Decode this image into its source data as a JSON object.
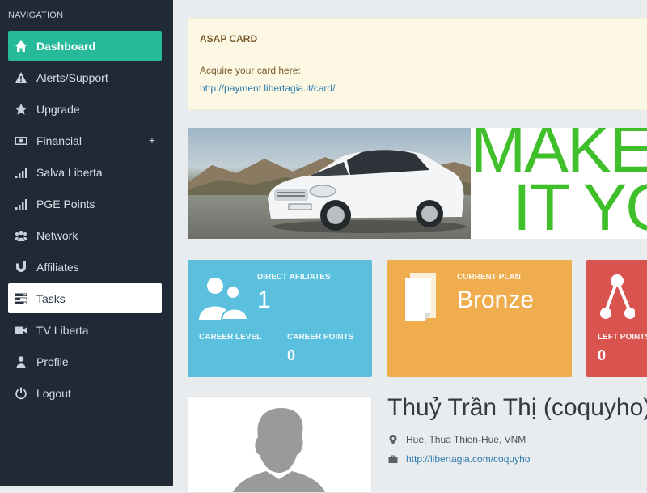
{
  "sidebar": {
    "heading": "NAVIGATION",
    "items": [
      {
        "label": "Dashboard",
        "icon": "home-icon",
        "state": "active"
      },
      {
        "label": "Alerts/Support",
        "icon": "warning-icon"
      },
      {
        "label": "Upgrade",
        "icon": "star-icon"
      },
      {
        "label": "Financial",
        "icon": "money-icon",
        "expand": "+"
      },
      {
        "label": "Salva Liberta",
        "icon": "signal-icon"
      },
      {
        "label": "PGE Points",
        "icon": "signal-icon"
      },
      {
        "label": "Network",
        "icon": "users-icon"
      },
      {
        "label": "Affiliates",
        "icon": "magnet-icon"
      },
      {
        "label": "Tasks",
        "icon": "tasks-icon",
        "state": "selected"
      },
      {
        "label": "TV Liberta",
        "icon": "video-icon"
      },
      {
        "label": "Profile",
        "icon": "user-icon"
      },
      {
        "label": "Logout",
        "icon": "power-icon"
      }
    ]
  },
  "alert": {
    "title": "ASAP CARD",
    "text": "Acquire your card here:",
    "link": "http://payment.libertagia.it/card/"
  },
  "banner": {
    "line1": "MAKE",
    "line2": "IT YO"
  },
  "cards": {
    "direct": {
      "label": "DIRECT AFILIATES",
      "value": "1",
      "color": "#5bc0de"
    },
    "career_level": {
      "label": "CAREER LEVEL",
      "value": ""
    },
    "career_points": {
      "label": "CAREER POINTS",
      "value": "0"
    },
    "plan": {
      "label": "CURRENT PLAN",
      "value": "Bronze",
      "color": "#f0ad4e"
    },
    "left_points": {
      "label": "LEFT POINTS",
      "value": "0",
      "color": "#d9534f"
    }
  },
  "profile": {
    "name": "Thuỷ Trần Thị (coquyho)",
    "location": "Hue, Thua Thien-Hue, VNM",
    "url": "http://libertagia.com/coquyho"
  },
  "colors": {
    "sidebar_bg": "#1f2a36",
    "active": "#26b99a",
    "accent_link": "#2a7ab0"
  }
}
